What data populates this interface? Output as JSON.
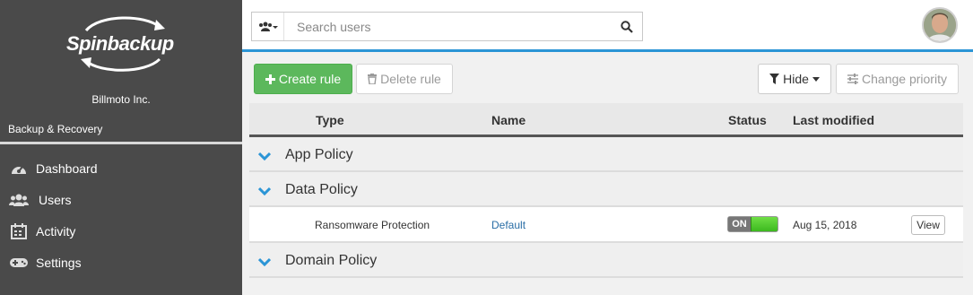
{
  "sidebar": {
    "logo_text": "Spinbackup",
    "company": "Billmoto Inc.",
    "section_label": "Backup & Recovery",
    "items": [
      {
        "label": "Dashboard",
        "icon": "dashboard-icon"
      },
      {
        "label": "Users",
        "icon": "users-icon"
      },
      {
        "label": "Activity",
        "icon": "calendar-icon"
      },
      {
        "label": "Settings",
        "icon": "gamepad-icon"
      }
    ]
  },
  "header": {
    "search_placeholder": "Search users",
    "group_icon": "users-dropdown-icon",
    "search_icon": "search-icon"
  },
  "toolbar": {
    "create_label": "Create rule",
    "delete_label": "Delete rule",
    "hide_label": "Hide",
    "priority_label": "Change priority"
  },
  "table": {
    "columns": [
      "Type",
      "Name",
      "Status",
      "Last modified"
    ],
    "groups": [
      {
        "label": "App Policy"
      },
      {
        "label": "Data Policy"
      },
      {
        "label": "Domain Policy"
      }
    ],
    "rows": [
      {
        "name": "Ransomware Protection",
        "type": "Default",
        "status": "ON",
        "modified": "Aug 15, 2018",
        "action": "View"
      }
    ]
  },
  "colors": {
    "accent": "#2b95d6",
    "sidebar": "#4a4a4a",
    "create_button": "#5cb85c",
    "toggle_on": "#4cc52a",
    "link": "#2a6ea6"
  }
}
